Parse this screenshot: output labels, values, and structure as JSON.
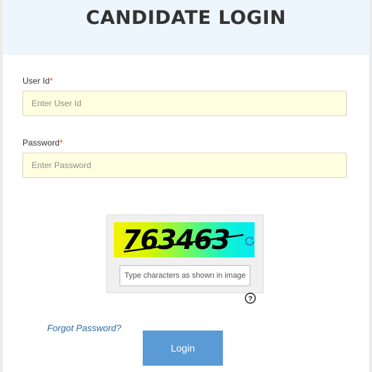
{
  "header": {
    "title": "CANDIDATE LOGIN"
  },
  "form": {
    "user_id": {
      "label": "User Id",
      "required_mark": "*",
      "placeholder": "Enter User Id",
      "value": ""
    },
    "password": {
      "label": "Password",
      "required_mark": "*",
      "placeholder": "Enter Password",
      "value": ""
    }
  },
  "captcha": {
    "image_text": "763463",
    "input_placeholder": "Type characters as shown in image",
    "refresh_icon": "refresh-icon",
    "help_icon": "question-circle-icon",
    "help_glyph": "?"
  },
  "links": {
    "forgot_password": "Forgot Password?"
  },
  "actions": {
    "login_label": "Login"
  },
  "colors": {
    "header_bg": "#eef6fd",
    "input_bg": "#ffffe0",
    "required": "#e0552a",
    "link": "#2e6da4",
    "button": "#5b9bd5"
  }
}
